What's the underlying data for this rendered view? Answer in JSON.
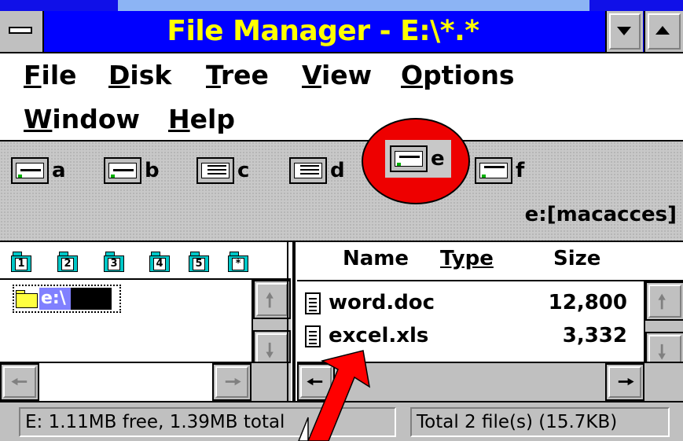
{
  "window": {
    "title": "File Manager - E:\\*.*"
  },
  "menu": {
    "items": [
      {
        "first": "F",
        "rest": "ile"
      },
      {
        "first": "D",
        "rest": "isk"
      },
      {
        "first": "T",
        "rest": "ree"
      },
      {
        "first": "V",
        "rest": "iew"
      },
      {
        "first": "O",
        "rest": "ptions"
      },
      {
        "first": "W",
        "rest": "indow"
      },
      {
        "first": "H",
        "rest": "elp"
      }
    ]
  },
  "drives": {
    "letters": [
      "a",
      "b",
      "c",
      "d",
      "e",
      "f"
    ],
    "selected": "e",
    "volume_label": "e:[macacces]"
  },
  "tree": {
    "levels": [
      "1",
      "2",
      "3",
      "4",
      "5",
      "*"
    ],
    "selected_item": "e:\\"
  },
  "files": {
    "columns": {
      "name": "Name",
      "type": "Type",
      "size": "Size"
    },
    "rows": [
      {
        "name": "word.doc",
        "size": "12,800"
      },
      {
        "name": "excel.xls",
        "size": "3,332"
      }
    ]
  },
  "status": {
    "left": "E: 1.11MB free, 1.39MB total",
    "right": "Total 2 file(s) (15.7KB)"
  },
  "colors": {
    "title_bg": "#0000ff",
    "title_text": "#ffff00",
    "highlight_circle": "#ee0000",
    "pointer_arrow": "#ff0000"
  },
  "icons": [
    "control-menu-icon",
    "minimize-icon",
    "maximize-icon",
    "drive-icon",
    "folder-level-icon",
    "open-folder-icon",
    "document-icon",
    "scroll-arrow-icon"
  ]
}
